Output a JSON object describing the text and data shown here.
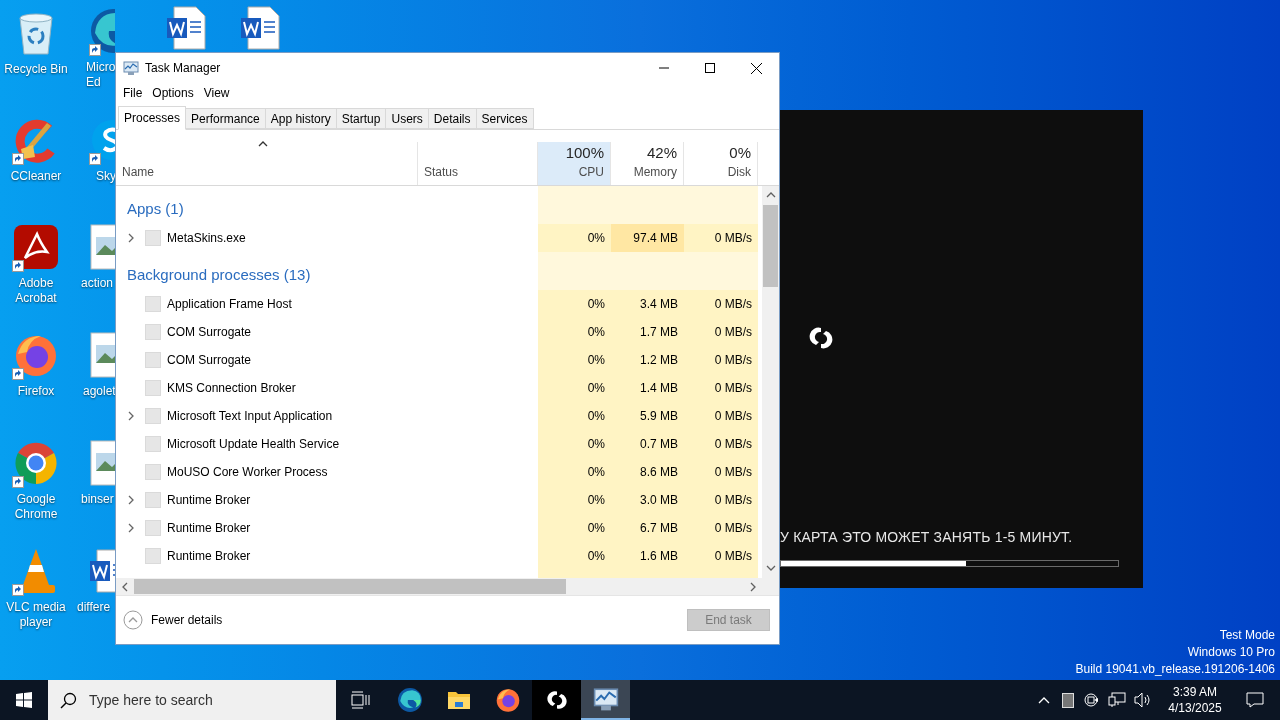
{
  "desktop_icons": [
    {
      "kind": "recycle",
      "label": [
        "Recycle Bin"
      ],
      "shortcut": false
    },
    {
      "kind": "ccleaner",
      "label": [
        "CCleaner"
      ],
      "shortcut": true
    },
    {
      "kind": "acrobat",
      "label": [
        "Adobe",
        "Acrobat"
      ],
      "shortcut": true
    },
    {
      "kind": "firefox",
      "label": [
        "Firefox"
      ],
      "shortcut": true
    },
    {
      "kind": "chrome",
      "label": [
        "Google",
        "Chrome"
      ],
      "shortcut": true
    },
    {
      "kind": "vlc",
      "label": [
        "VLC media",
        "player"
      ],
      "shortcut": true
    },
    {
      "kind": "edge",
      "label": [
        "Micro",
        "Ed"
      ],
      "shortcut": true
    },
    {
      "kind": "skype",
      "label": [
        "Sky"
      ],
      "shortcut": true
    },
    {
      "kind": "image",
      "label": [
        "action"
      ],
      "shortcut": false
    },
    {
      "kind": "image",
      "label": [
        "agolet"
      ],
      "shortcut": false
    },
    {
      "kind": "image",
      "label": [
        "binser"
      ],
      "shortcut": false
    },
    {
      "kind": "word",
      "label": [
        "differe"
      ],
      "shortcut": false
    },
    {
      "kind": "word",
      "shortcut": false
    },
    {
      "kind": "word",
      "shortcut": false
    }
  ],
  "game_window": {
    "message": "У КАРТА ЭТО МОЖЕТ ЗАНЯТЬ 1-5 МИНУТ.",
    "progress": {
      "level": 0.55
    }
  },
  "task_manager": {
    "title": "Task Manager",
    "menu": [
      "File",
      "Options",
      "View"
    ],
    "tabs": [
      {
        "label": "Processes",
        "selected": true
      },
      {
        "label": "Performance",
        "selected": false
      },
      {
        "label": "App history",
        "selected": false
      },
      {
        "label": "Startup",
        "selected": false
      },
      {
        "label": "Users",
        "selected": false
      },
      {
        "label": "Details",
        "selected": false
      },
      {
        "label": "Services",
        "selected": false
      }
    ],
    "columns": [
      {
        "kind": "name",
        "label": "Name"
      },
      {
        "kind": "status",
        "label": "Status"
      },
      {
        "kind": "metric",
        "percent": "100%",
        "label": "CPU",
        "selected": true
      },
      {
        "kind": "metric",
        "percent": "42%",
        "label": "Memory",
        "selected": false
      },
      {
        "kind": "metric",
        "percent": "0%",
        "label": "Disk",
        "selected": false
      }
    ],
    "groups": [
      {
        "title": "Apps (1)",
        "rows": [
          {
            "name": "MetaSkins.exe",
            "expandable": true,
            "cpu": "0%",
            "memory": "97.4 MB",
            "disk": "0 MB/s",
            "memory_high": true
          }
        ]
      },
      {
        "title": "Background processes (13)",
        "rows": [
          {
            "name": "Application Frame Host",
            "expandable": false,
            "cpu": "0%",
            "memory": "3.4 MB",
            "disk": "0 MB/s",
            "memory_high": false
          },
          {
            "name": "COM Surrogate",
            "expandable": false,
            "cpu": "0%",
            "memory": "1.7 MB",
            "disk": "0 MB/s",
            "memory_high": false
          },
          {
            "name": "COM Surrogate",
            "expandable": false,
            "cpu": "0%",
            "memory": "1.2 MB",
            "disk": "0 MB/s",
            "memory_high": false
          },
          {
            "name": "KMS Connection Broker",
            "expandable": false,
            "cpu": "0%",
            "memory": "1.4 MB",
            "disk": "0 MB/s",
            "memory_high": false
          },
          {
            "name": "Microsoft Text Input Application",
            "expandable": true,
            "cpu": "0%",
            "memory": "5.9 MB",
            "disk": "0 MB/s",
            "memory_high": false
          },
          {
            "name": "Microsoft Update Health Service",
            "expandable": false,
            "cpu": "0%",
            "memory": "0.7 MB",
            "disk": "0 MB/s",
            "memory_high": false
          },
          {
            "name": "MoUSO Core Worker Process",
            "expandable": false,
            "cpu": "0%",
            "memory": "8.6 MB",
            "disk": "0 MB/s",
            "memory_high": false
          },
          {
            "name": "Runtime Broker",
            "expandable": true,
            "cpu": "0%",
            "memory": "3.0 MB",
            "disk": "0 MB/s",
            "memory_high": false
          },
          {
            "name": "Runtime Broker",
            "expandable": true,
            "cpu": "0%",
            "memory": "6.7 MB",
            "disk": "0 MB/s",
            "memory_high": false
          },
          {
            "name": "Runtime Broker",
            "expandable": false,
            "cpu": "0%",
            "memory": "1.6 MB",
            "disk": "0 MB/s",
            "memory_high": false
          }
        ]
      }
    ],
    "footer": {
      "toggle": "Fewer details",
      "end_task": {
        "label": "End task",
        "disabled": true
      }
    }
  },
  "system_watermark": [
    "Test Mode",
    "Windows 10 Pro",
    "Build 19041.vb_release.191206-1406"
  ],
  "taskbar": {
    "search_placeholder": "Type here to search",
    "apps": [
      {
        "kind": "taskview",
        "selected": false
      },
      {
        "kind": "edge",
        "selected": false
      },
      {
        "kind": "explorer",
        "selected": false
      },
      {
        "kind": "firefox",
        "selected": false
      },
      {
        "kind": "metaskins",
        "selected": false
      },
      {
        "kind": "taskmanager",
        "selected": true
      }
    ],
    "time": "3:39 AM",
    "date": "4/13/2025"
  }
}
